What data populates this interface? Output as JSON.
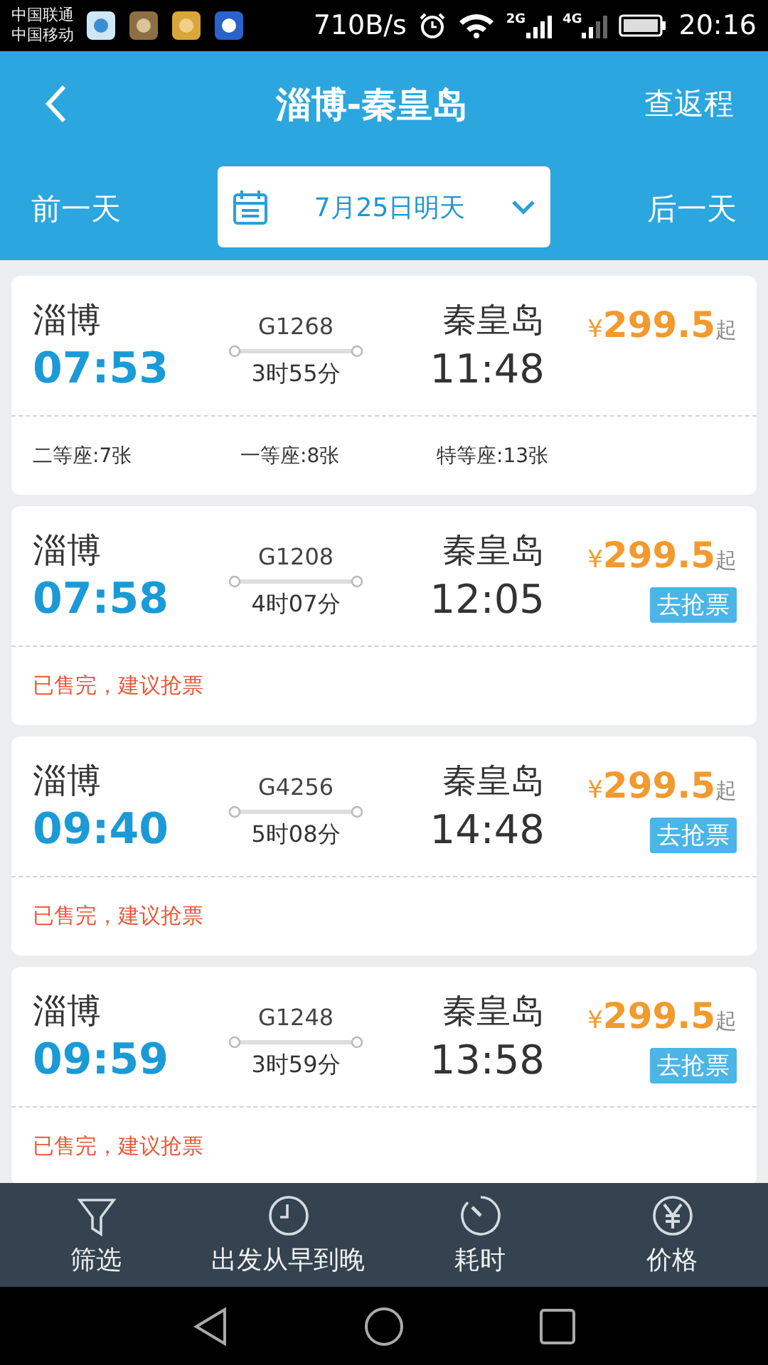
{
  "status_bar": {
    "carriers": [
      "中国联通",
      "中国移动"
    ],
    "speed": "710B/s",
    "signals": [
      {
        "label": "2G"
      },
      {
        "label": "4G"
      }
    ],
    "time": "20:16"
  },
  "header": {
    "title": "淄博-秦皇岛",
    "action": "查返程"
  },
  "date_bar": {
    "prev": "前一天",
    "date": "7月25日明天",
    "next": "后一天"
  },
  "trains": [
    {
      "kind": "seats",
      "from": "淄博",
      "depart": "07:53",
      "number": "G1268",
      "duration": "3时55分",
      "to": "秦皇岛",
      "arrive": "11:48",
      "currency": "¥",
      "price": "299.5",
      "price_suffix": "起",
      "seats": [
        "二等座:7张",
        "一等座:8张",
        "特等座:13张"
      ]
    },
    {
      "kind": "sold_out",
      "from": "淄博",
      "depart": "07:58",
      "number": "G1208",
      "duration": "4时07分",
      "to": "秦皇岛",
      "arrive": "12:05",
      "currency": "¥",
      "price": "299.5",
      "price_suffix": "起",
      "action": "去抢票",
      "notice": "已售完，建议抢票"
    },
    {
      "kind": "sold_out",
      "from": "淄博",
      "depart": "09:40",
      "number": "G4256",
      "duration": "5时08分",
      "to": "秦皇岛",
      "arrive": "14:48",
      "currency": "¥",
      "price": "299.5",
      "price_suffix": "起",
      "action": "去抢票",
      "notice": "已售完，建议抢票"
    },
    {
      "kind": "sold_out",
      "from": "淄博",
      "depart": "09:59",
      "number": "G1248",
      "duration": "3时59分",
      "to": "秦皇岛",
      "arrive": "13:58",
      "currency": "¥",
      "price": "299.5",
      "price_suffix": "起",
      "action": "去抢票",
      "notice": "已售完，建议抢票"
    }
  ],
  "bottom_tabs": [
    {
      "kind": "filter",
      "label": "筛选"
    },
    {
      "kind": "clock",
      "label": "出发从早到晚"
    },
    {
      "kind": "timer",
      "label": "耗时"
    },
    {
      "kind": "yen",
      "label": "价格"
    }
  ]
}
